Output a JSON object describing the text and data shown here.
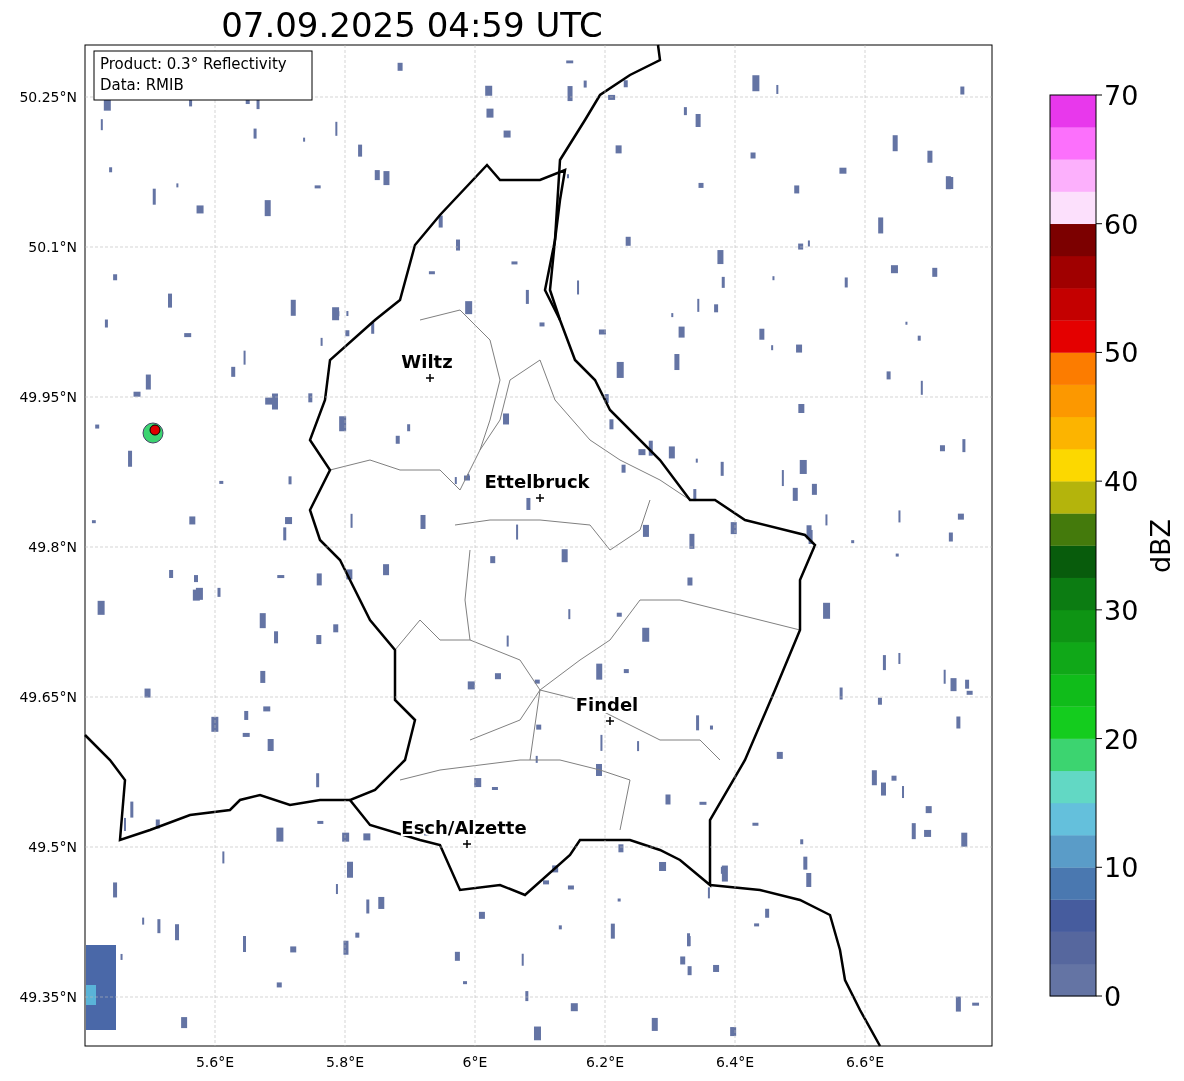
{
  "title": "07.09.2025 04:59 UTC",
  "info_box": [
    "Product: 0.3° Reflectivity",
    "Data: RMIB"
  ],
  "lat_ticks": [
    "50.25°N",
    "50.1°N",
    "49.95°N",
    "49.8°N",
    "49.65°N",
    "49.5°N",
    "49.35°N"
  ],
  "lon_ticks": [
    "5.6°E",
    "5.8°E",
    "6°E",
    "6.2°E",
    "6.4°E",
    "6.6°E"
  ],
  "cities": [
    {
      "name": "Wiltz"
    },
    {
      "name": "Ettelbruck"
    },
    {
      "name": "Findel"
    },
    {
      "name": "Esch/Alzette"
    }
  ],
  "colorbar": {
    "label": "dBZ",
    "ticks": [
      "70",
      "60",
      "50",
      "40",
      "30",
      "20",
      "10",
      "0"
    ],
    "bands": [
      {
        "color": "#6474a4"
      },
      {
        "color": "#56679e"
      },
      {
        "color": "#465c9e"
      },
      {
        "color": "#4a78b0"
      },
      {
        "color": "#5a9cc8"
      },
      {
        "color": "#64c0dc"
      },
      {
        "color": "#62d8c4"
      },
      {
        "color": "#3cd470"
      },
      {
        "color": "#14cc1e"
      },
      {
        "color": "#10bc1a"
      },
      {
        "color": "#10a818"
      },
      {
        "color": "#0e9414"
      },
      {
        "color": "#0c7c12"
      },
      {
        "color": "#085c0c"
      },
      {
        "color": "#447a0c"
      },
      {
        "color": "#b4b40c"
      },
      {
        "color": "#fcd800"
      },
      {
        "color": "#fcb400"
      },
      {
        "color": "#fc9800"
      },
      {
        "color": "#fc7c00"
      },
      {
        "color": "#e40000"
      },
      {
        "color": "#c40000"
      },
      {
        "color": "#a00000"
      },
      {
        "color": "#7c0000"
      },
      {
        "color": "#fce0fc"
      },
      {
        "color": "#fcb0fc"
      },
      {
        "color": "#fc70fc"
      },
      {
        "color": "#e838ec"
      }
    ]
  }
}
